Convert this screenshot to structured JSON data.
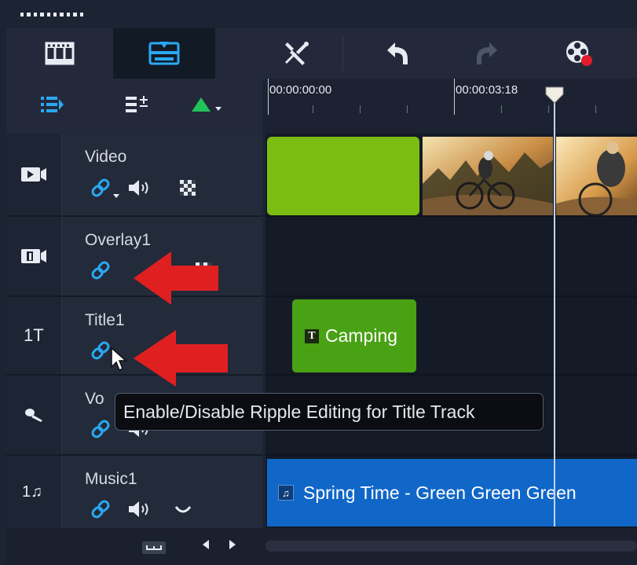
{
  "toolbar": {
    "buttons": [
      {
        "name": "storyboard-view-icon"
      },
      {
        "name": "timeline-view-icon",
        "active": true
      },
      {
        "name": "tools-icon"
      },
      {
        "name": "undo-icon"
      },
      {
        "name": "redo-icon",
        "disabled": true
      },
      {
        "name": "record-capture-icon"
      }
    ],
    "accent_color": "#2aa8f2"
  },
  "track_manager": {
    "icons": [
      "track-manager-icon",
      "chapter-cue-menu-icon",
      "add-track-menu-icon"
    ]
  },
  "ruler": {
    "labels": [
      "00:00:00:00",
      "00:00:03:18"
    ]
  },
  "tracks": [
    {
      "name": "Video",
      "icon": "video-track-icon",
      "controls": [
        "ripple-link-icon",
        "volume-icon",
        "transparency-icon"
      ]
    },
    {
      "name": "Overlay1",
      "icon": "overlay-track-icon",
      "controls": [
        "ripple-link-icon",
        "transparency-icon"
      ]
    },
    {
      "name": "Title1",
      "icon_text": "1T",
      "controls": [
        "ripple-link-icon"
      ]
    },
    {
      "name": "Vo",
      "icon": "voice-track-icon",
      "controls": [
        "ripple-link-icon",
        "volume-icon"
      ]
    },
    {
      "name": "Music1",
      "icon_text": "1♫",
      "controls": [
        "ripple-link-icon",
        "volume-icon",
        "fade-icon"
      ]
    }
  ],
  "clips": {
    "title_clip": {
      "badge": "T",
      "label": "Camping",
      "color": "#49a114"
    },
    "music_clip": {
      "badge": "♫",
      "label": "Spring Time - Green Green Green",
      "color": "#1067c7"
    },
    "color_clip": {
      "color": "#7bbd12"
    }
  },
  "tooltip": {
    "text": "Enable/Disable Ripple Editing for Title Track"
  },
  "annotations": {
    "arrow_color": "#e02020"
  }
}
